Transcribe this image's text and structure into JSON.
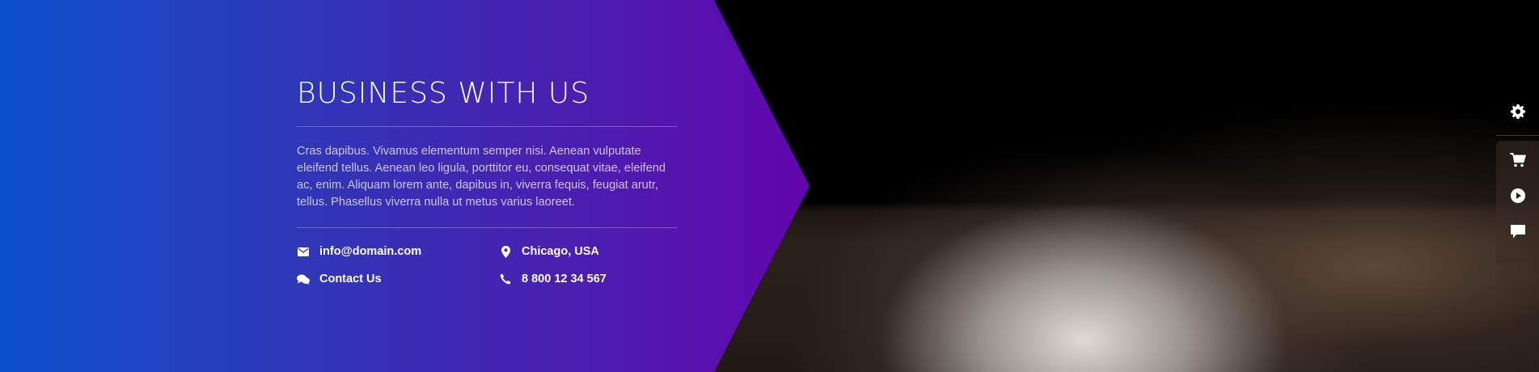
{
  "section": {
    "title": "BUSINESS WITH US",
    "description": "Cras dapibus. Vivamus elementum semper nisi. Aenean vulputate eleifend tellus. Aenean leo ligula, porttitor eu, consequat vitae, eleifend ac, enim. Aliquam lorem ante, dapibus in, viverra fequis, feugiat arutr, tellus. Phasellus viverra nulla ut metus varius laoreet."
  },
  "contacts": {
    "email": {
      "icon": "envelope-icon",
      "label": "info@domain.com"
    },
    "contact_us": {
      "icon": "chat-icon",
      "label": "Contact Us"
    },
    "location": {
      "icon": "map-marker-icon",
      "label": "Chicago, USA"
    },
    "phone": {
      "icon": "phone-icon",
      "label": "8 800 12 34 567"
    }
  },
  "sidebar": {
    "items": [
      {
        "icon": "gear-icon"
      },
      {
        "icon": "cart-icon"
      },
      {
        "icon": "play-icon"
      },
      {
        "icon": "comment-icon"
      }
    ]
  },
  "colors": {
    "gradient_start": "#0c4fcc",
    "gradient_end": "#6206ad",
    "text": "#ffffff"
  }
}
